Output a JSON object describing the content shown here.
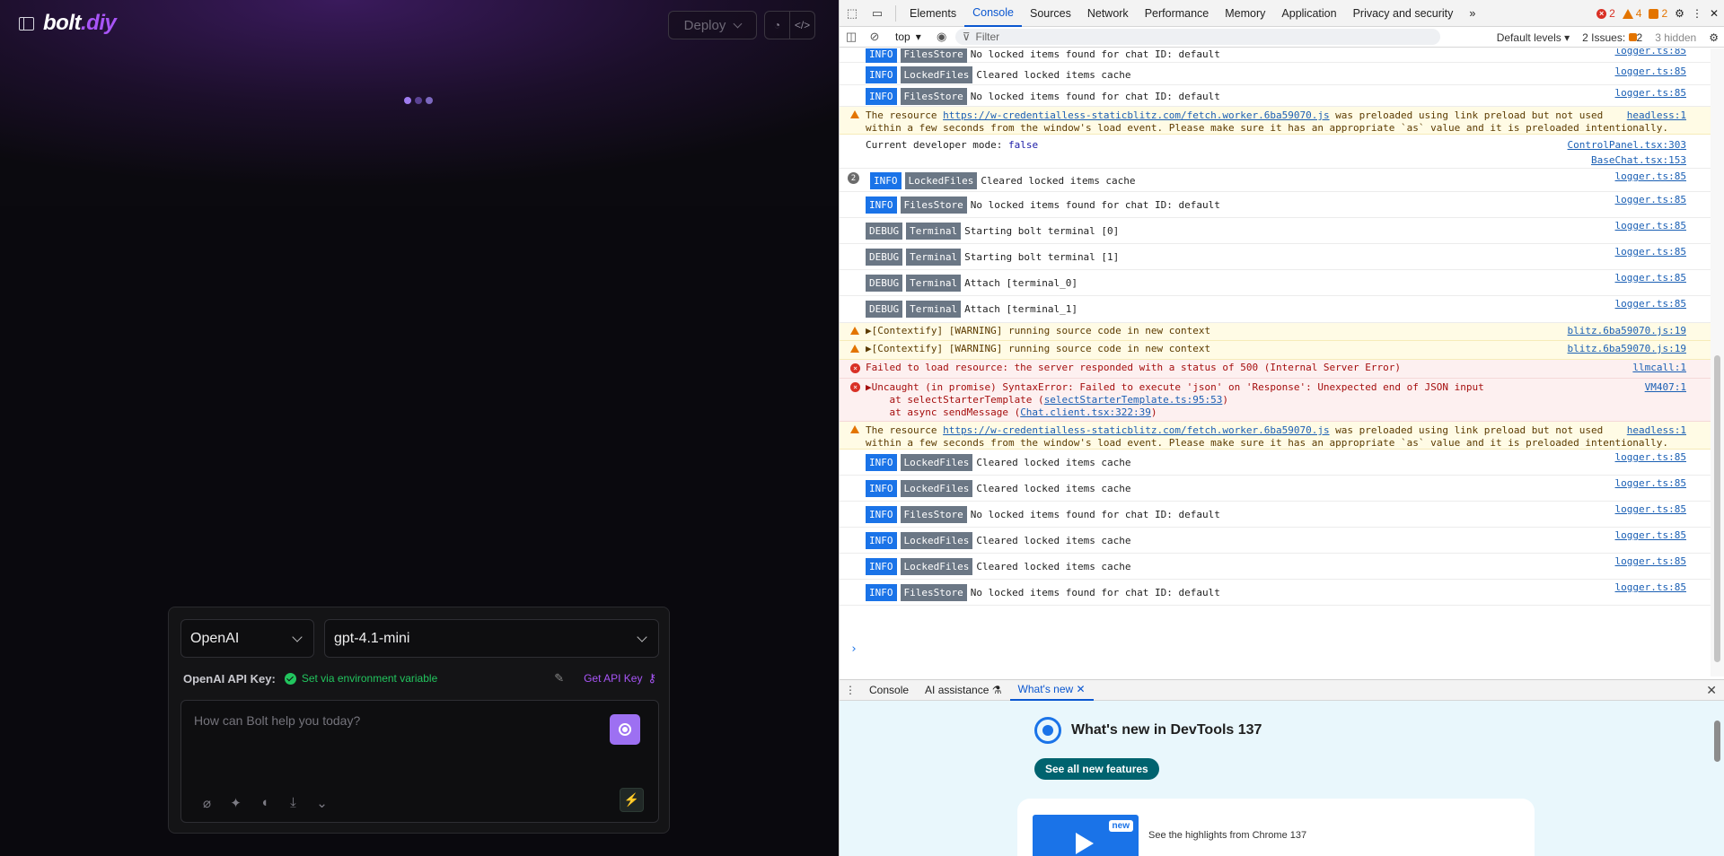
{
  "app": {
    "logo_text": "bolt",
    "logo_suffix": ".diy",
    "deploy_label": "Deploy",
    "provider": "OpenAI",
    "model": "gpt-4.1-mini",
    "api_label": "OpenAI API Key:",
    "api_status": "Set via environment variable",
    "get_api_key": "Get API Key",
    "prompt_placeholder": "How can Bolt help you today?",
    "colors": {
      "accent": "#a855f7",
      "success": "#22c55e"
    }
  },
  "devtools": {
    "tabs": [
      "Elements",
      "Console",
      "Sources",
      "Network",
      "Performance",
      "Memory",
      "Application",
      "Privacy and security"
    ],
    "active_tab": "Console",
    "more_tabs": "»",
    "error_count": "2",
    "warning_count": "4",
    "issue_count": "2",
    "context": "top",
    "filter_placeholder": "Filter",
    "levels": "Default levels",
    "issues_label": "2 Issues:",
    "issues_count": "2",
    "hidden_label": "3 hidden",
    "logs": {
      "r0": {
        "level": "INFO",
        "module": "FilesStore",
        "text": "No locked items found for chat ID: default",
        "src": "logger.ts:85"
      },
      "r1": {
        "level": "INFO",
        "module": "LockedFiles",
        "text": "Cleared locked items cache",
        "src": "logger.ts:85"
      },
      "r2": {
        "level": "INFO",
        "module": "FilesStore",
        "text": "No locked items found for chat ID: default",
        "src": "logger.ts:85"
      },
      "w1": {
        "pre": "The resource ",
        "link": "https://w-credentialless-staticblitz.com/fetch.worker.6ba59070.js",
        "post": " was preloaded using link preload but not used",
        "line2": "within a few seconds from the window's load event. Please make sure it has an appropriate `as` value and it is preloaded intentionally.",
        "src": "headless:1"
      },
      "d1": {
        "text": "Current developer mode: ",
        "val": "false",
        "src": "ControlPanel.tsx:303",
        "src2": "BaseChat.tsx:153"
      },
      "r3": {
        "count": "2",
        "level": "INFO",
        "module": "LockedFiles",
        "text": "Cleared locked items cache",
        "src": "logger.ts:85"
      },
      "r4": {
        "level": "INFO",
        "module": "FilesStore",
        "text": "No locked items found for chat ID: default",
        "src": "logger.ts:85"
      },
      "r5": {
        "level": "DEBUG",
        "module": "Terminal",
        "text": "Starting bolt terminal [0]",
        "src": "logger.ts:85"
      },
      "r6": {
        "level": "DEBUG",
        "module": "Terminal",
        "text": "Starting bolt terminal [1]",
        "src": "logger.ts:85"
      },
      "r7": {
        "level": "DEBUG",
        "module": "Terminal",
        "text": "Attach [terminal_0]",
        "src": "logger.ts:85"
      },
      "r8": {
        "level": "DEBUG",
        "module": "Terminal",
        "text": "Attach [terminal_1]",
        "src": "logger.ts:85"
      },
      "w2": {
        "text": "▶[Contextify] [WARNING] running source code in new context",
        "src": "blitz.6ba59070.js:19"
      },
      "w3": {
        "text": "▶[Contextify] [WARNING] running source code in new context",
        "src": "blitz.6ba59070.js:19"
      },
      "e1": {
        "text": "Failed to load resource: the server responded with a status of 500 (Internal Server Error)",
        "src": "llmcall:1"
      },
      "e2": {
        "text": "▶Uncaught (in promise) SyntaxError: Failed to execute 'json' on 'Response': Unexpected end of JSON input",
        "l2a": "    at selectStarterTemplate (",
        "l2link": "selectStarterTemplate.ts:95:53",
        "l2b": ")",
        "l3a": "    at async sendMessage (",
        "l3link": "Chat.client.tsx:322:39",
        "l3b": ")",
        "src": "VM407:1"
      },
      "w4": {
        "pre": "The resource ",
        "link": "https://w-credentialless-staticblitz.com/fetch.worker.6ba59070.js",
        "post": " was preloaded using link preload but not used",
        "line2": "within a few seconds from the window's load event. Please make sure it has an appropriate `as` value and it is preloaded intentionally.",
        "src": "headless:1"
      },
      "r9": {
        "level": "INFO",
        "module": "LockedFiles",
        "text": "Cleared locked items cache",
        "src": "logger.ts:85"
      },
      "r10": {
        "level": "INFO",
        "module": "LockedFiles",
        "text": "Cleared locked items cache",
        "src": "logger.ts:85"
      },
      "r11": {
        "level": "INFO",
        "module": "FilesStore",
        "text": "No locked items found for chat ID: default",
        "src": "logger.ts:85"
      },
      "r12": {
        "level": "INFO",
        "module": "LockedFiles",
        "text": "Cleared locked items cache",
        "src": "logger.ts:85"
      },
      "r13": {
        "level": "INFO",
        "module": "LockedFiles",
        "text": "Cleared locked items cache",
        "src": "logger.ts:85"
      },
      "r14": {
        "level": "INFO",
        "module": "FilesStore",
        "text": "No locked items found for chat ID: default",
        "src": "logger.ts:85"
      }
    },
    "drawer_tabs": {
      "console": "Console",
      "ai": "AI assistance",
      "whatsnew": "What's new"
    },
    "whatsnew_title": "What's new in DevTools 137",
    "whatsnew_button": "See all new features",
    "whatsnew_badge": "new",
    "whatsnew_card": "See the highlights from Chrome 137"
  }
}
